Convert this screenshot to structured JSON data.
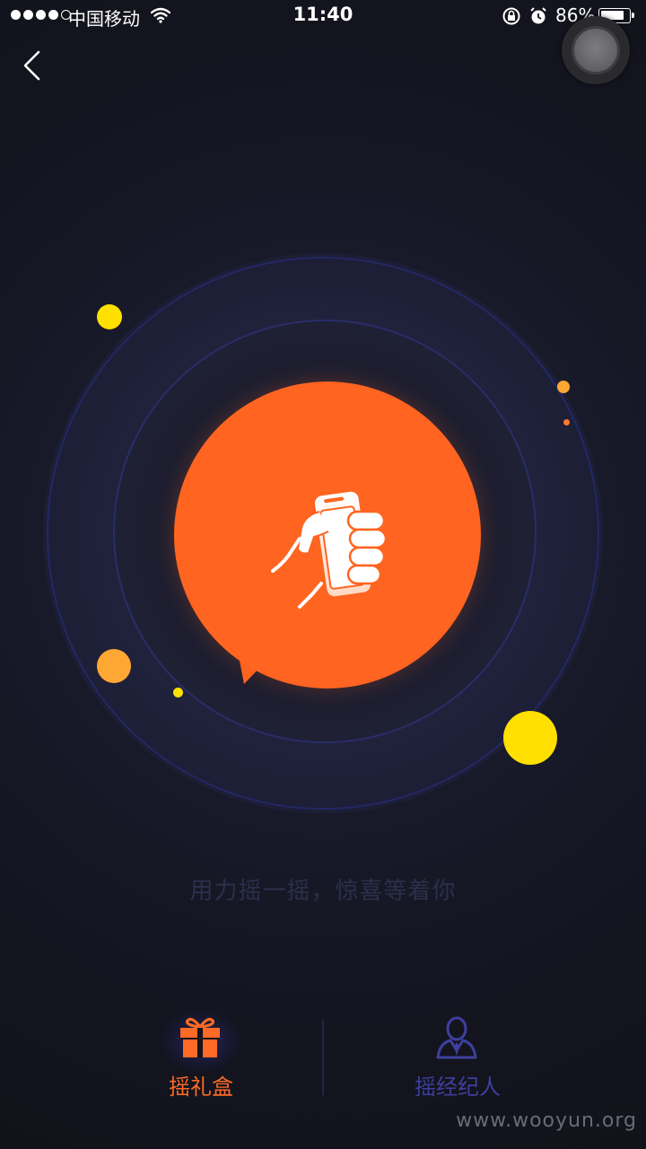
{
  "status_bar": {
    "carrier": "中国移动",
    "time": "11:40",
    "battery_percent_label": "86%",
    "battery_level": 0.86
  },
  "colors": {
    "accent": "#ff6420",
    "active_tab": "#ff6a26",
    "inactive_tab": "#3e3f9e",
    "yellow_dot": "#ffe000",
    "orange_dot": "#ffa733",
    "background": "#13141d"
  },
  "icons": {
    "back": "chevron-left-icon",
    "shake": "hand-holding-phone-icon",
    "gift_tab": "gift-icon",
    "agent_tab": "agent-person-icon",
    "assistive_touch": "assistive-touch-icon"
  },
  "main": {
    "hint_text": "用力摇一摇，惊喜等着你"
  },
  "tabs": [
    {
      "label": "摇礼盒",
      "active": true
    },
    {
      "label": "摇经纪人",
      "active": false
    }
  ],
  "watermark": "www.wooyun.org"
}
